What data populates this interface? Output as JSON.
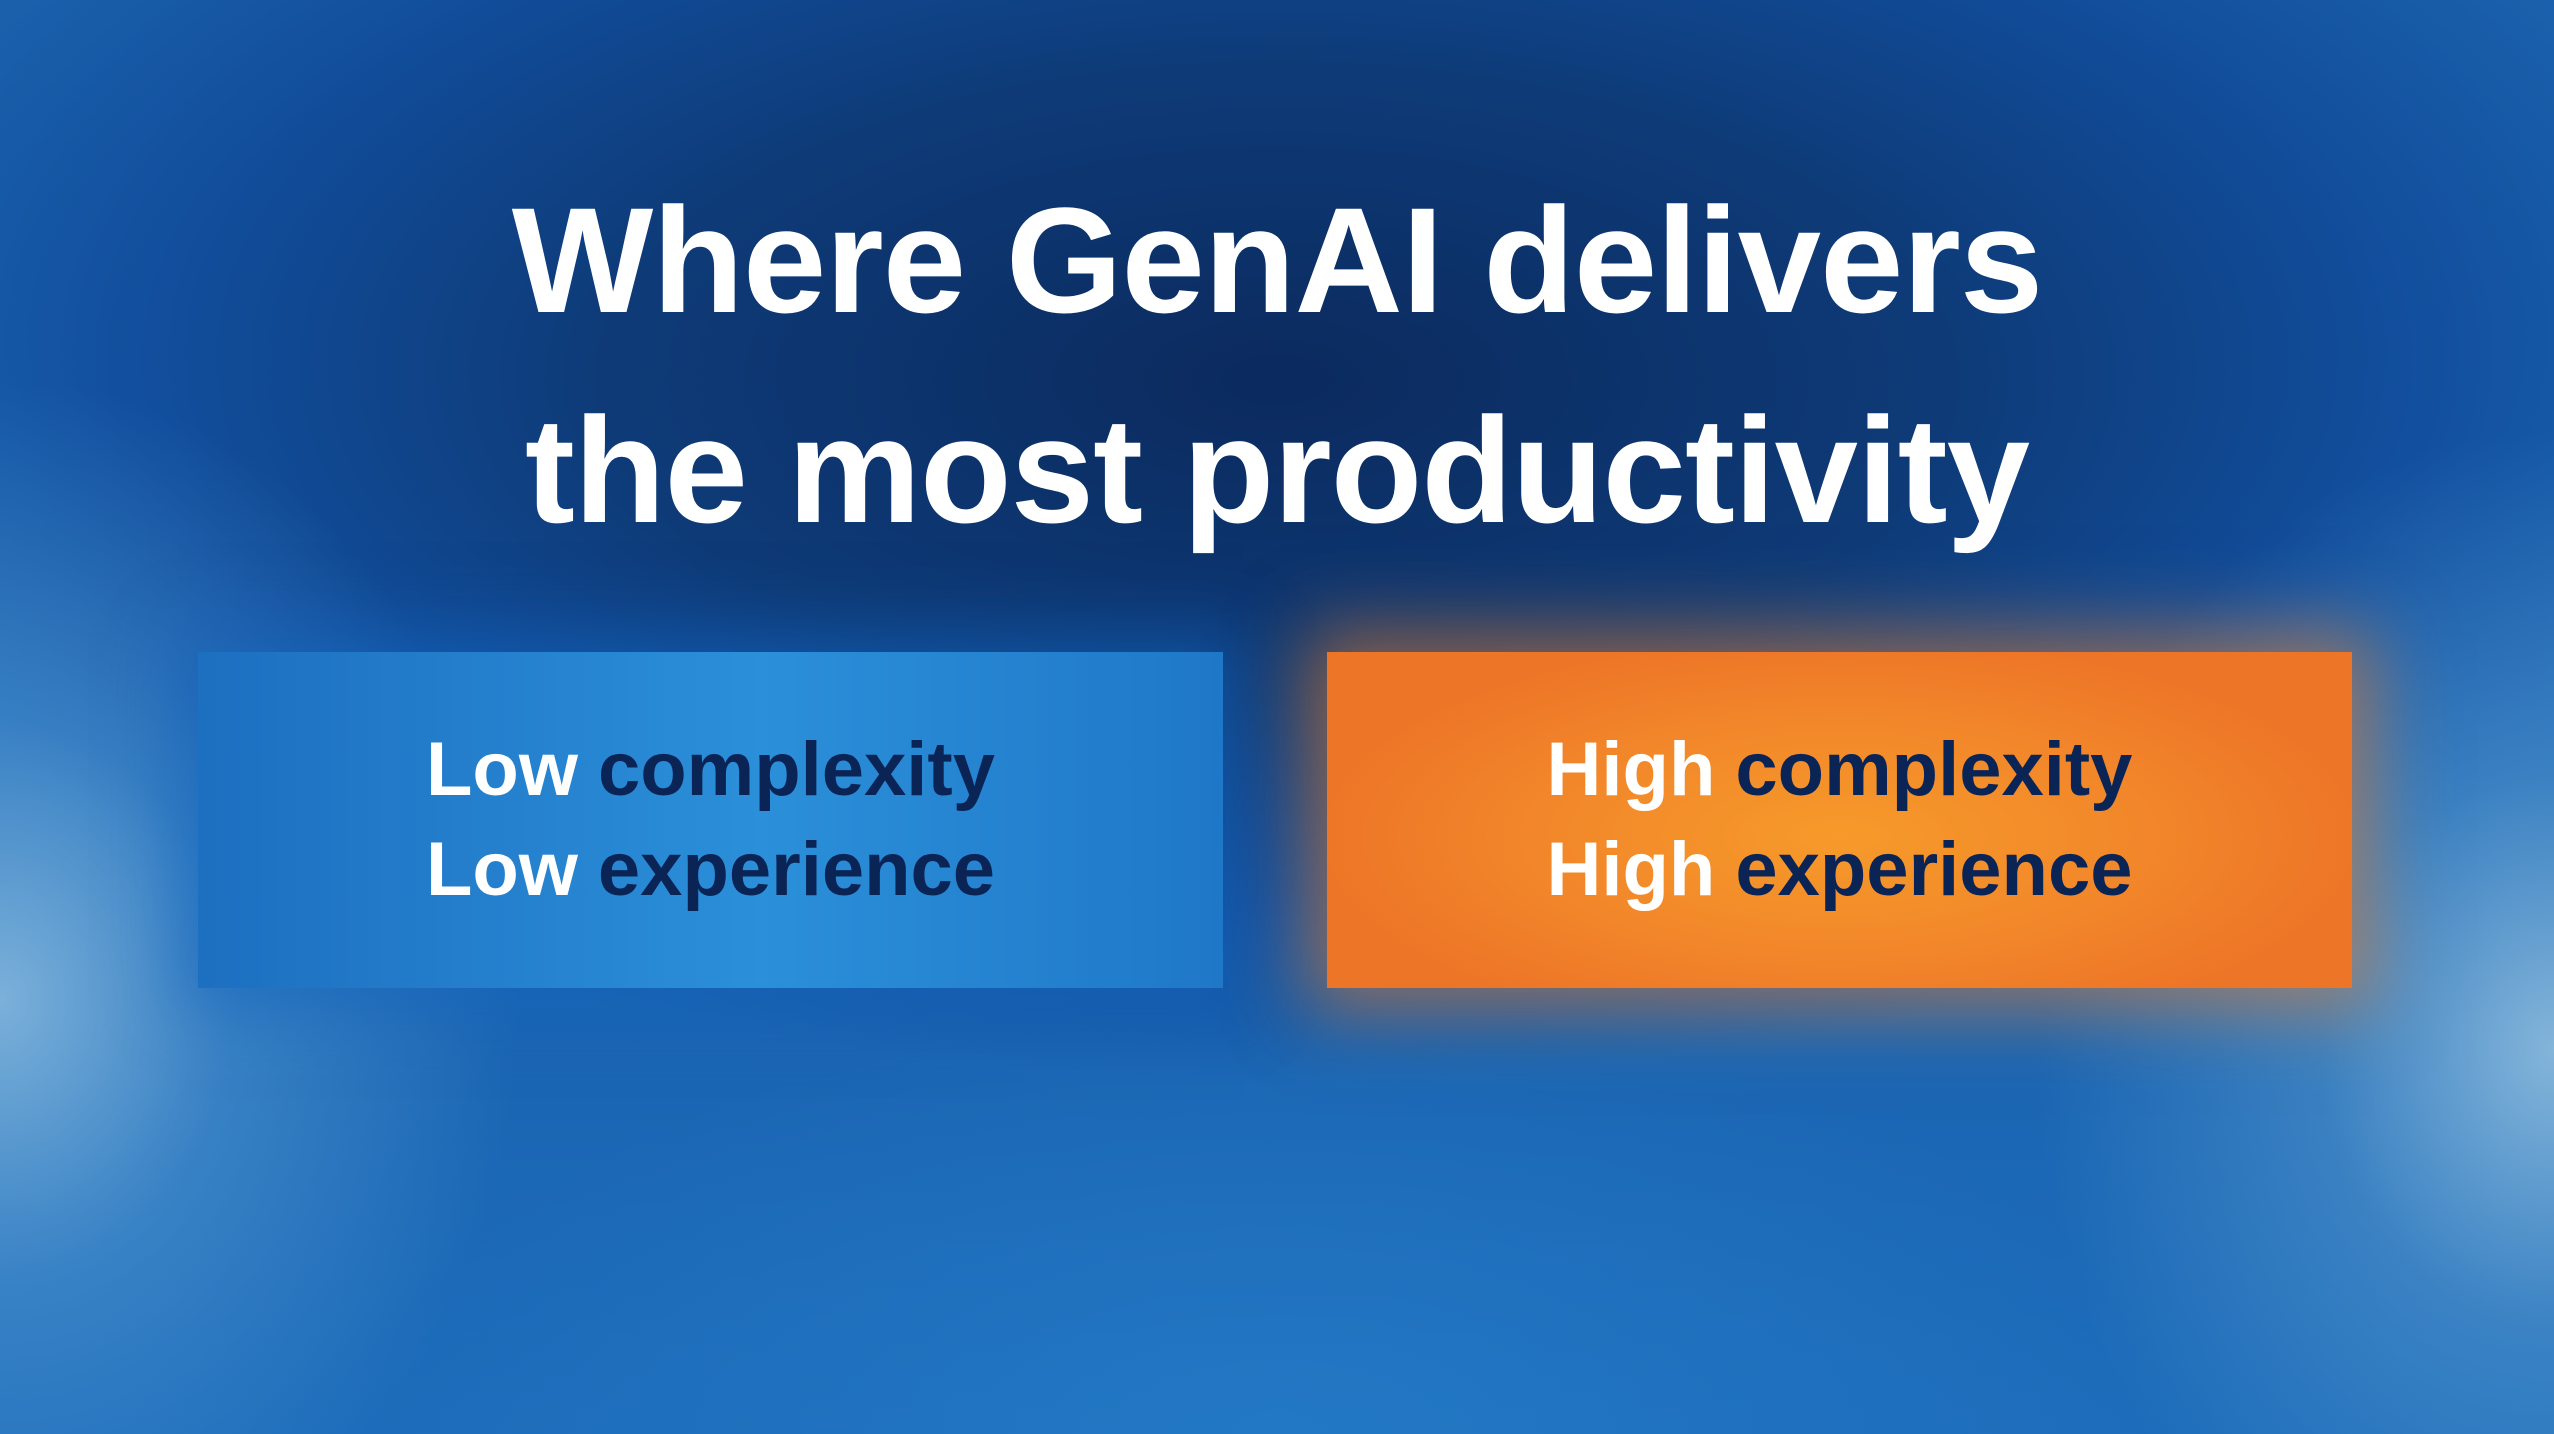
{
  "slide": {
    "title_line1": "Where GenAI delivers",
    "title_line2": "the most productivity"
  },
  "cards": {
    "left": {
      "line1_word1": "Low",
      "line1_word2": "complexity",
      "line2_word1": "Low",
      "line2_word2": "experience"
    },
    "right": {
      "line1_word1": "High",
      "line1_word2": "complexity",
      "line2_word1": "High",
      "line2_word2": "experience"
    }
  },
  "colors": {
    "left_card": "#2b8fd9",
    "right_card": "#f2862a",
    "title_text": "#ffffff",
    "highlight_text": "#0b2456"
  }
}
